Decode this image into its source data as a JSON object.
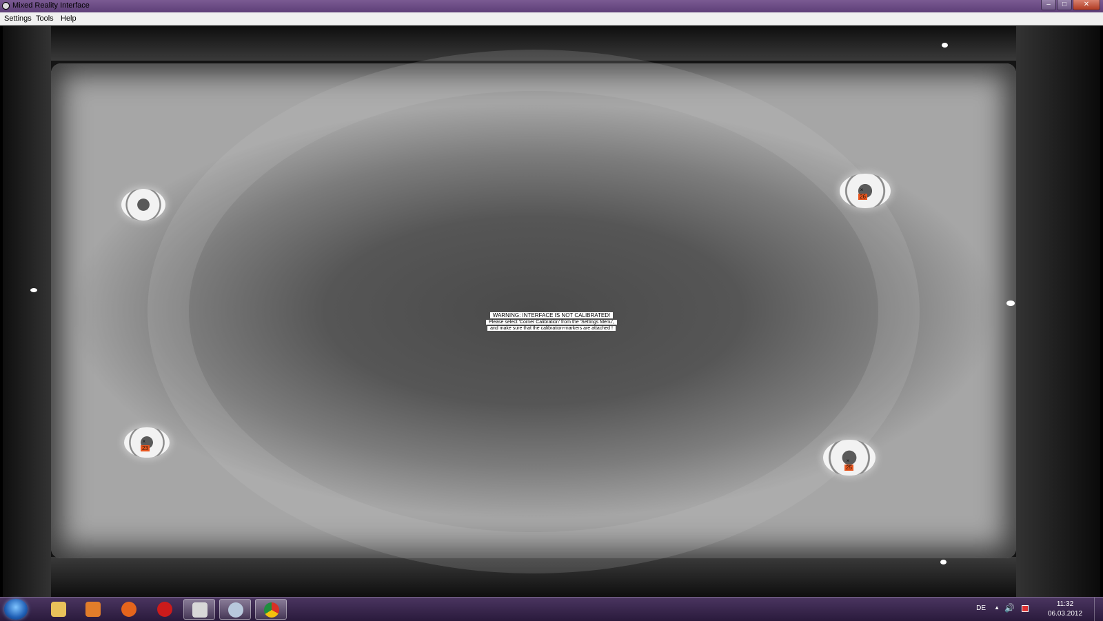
{
  "window": {
    "title": "Mixed Reality Interface",
    "min_glyph": "–",
    "max_glyph": "□",
    "close_glyph": "✕"
  },
  "menu": {
    "items": [
      "Settings",
      "Tools",
      "Help"
    ]
  },
  "camera_view": {
    "warning": {
      "line1": "WARNING: INTERFACE IS NOT CALIBRATED!",
      "line2": "Please select 'Corner Calibration' from the 'Settings Menu',",
      "line3": "and make sure that the calibration-markers are attached !"
    },
    "markers": [
      {
        "id": "",
        "cross": ""
      },
      {
        "id": "26",
        "cross": "×"
      },
      {
        "id": "23",
        "cross": "×"
      },
      {
        "id": "25",
        "cross": "×"
      }
    ]
  },
  "taskbar": {
    "apps": [
      {
        "name": "file-explorer",
        "color": "#e9c25a"
      },
      {
        "name": "media-player",
        "color": "#e27d2a"
      },
      {
        "name": "firefox",
        "color": "#e5651c"
      },
      {
        "name": "opera",
        "color": "#cc1b1b"
      },
      {
        "name": "camera-app",
        "color": "#d8d8d8"
      },
      {
        "name": "paint-app",
        "color": "#b8c9dc"
      },
      {
        "name": "chrome",
        "color": "#3a8f3a"
      }
    ],
    "tray": {
      "language": "DE",
      "time": "11:32",
      "date": "06.03.2012"
    }
  }
}
